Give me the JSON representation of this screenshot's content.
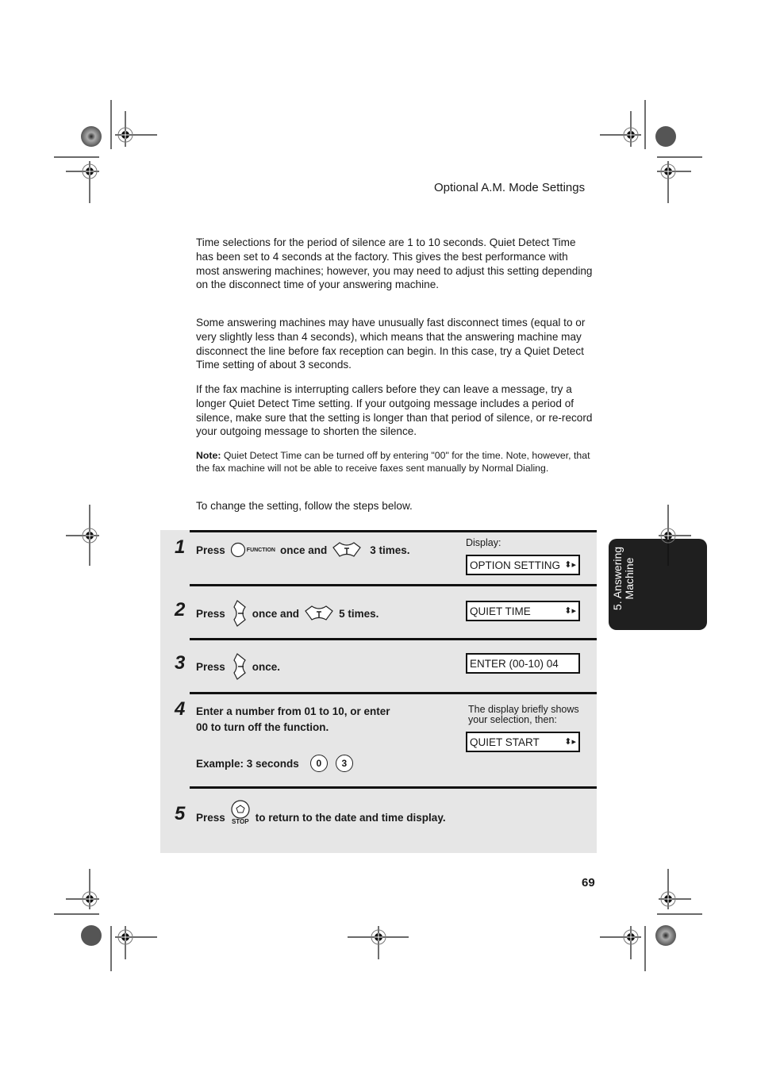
{
  "header": {
    "section_title": "Optional A.M. Mode Settings"
  },
  "body": {
    "paragraphs": [
      "Time selections for the period of silence are 1 to 10 seconds. Quiet Detect Time has been set to 4 seconds at the factory. This gives the best performance with most answering machines; however, you may need to adjust this setting depending on the disconnect time of your answering machine.",
      "Some answering machines may have unusually fast disconnect times (equal to or very slightly less than 4 seconds), which means that the answering machine may disconnect the line before fax reception can begin. In this case, try a Quiet Detect Time setting of about 3 seconds.",
      "If the fax machine is interrupting callers before they can leave a message, try a longer Quiet Detect Time setting. If your outgoing message includes a period of silence, make sure that the setting is longer than that period of silence, or re-record your outgoing message to shorten the silence."
    ],
    "note_label": "Note:",
    "note_text": " Quiet Detect Time can be turned off by entering \"00\" for the time. Note, however, that the fax machine will not be able to receive faxes sent manually by Normal Dialing.",
    "intro": "To change the setting, follow the steps below."
  },
  "steps": [
    {
      "number": "1",
      "press": "Press",
      "key1": "FUNCTION",
      "mid": "once and",
      "end": "3 times.",
      "display_label": "Display:",
      "display": "OPTION SETTING"
    },
    {
      "number": "2",
      "press": "Press",
      "mid": "once and",
      "end": "5 times.",
      "display": "QUIET TIME"
    },
    {
      "number": "3",
      "press": "Press",
      "end": "once.",
      "display": "ENTER (00-10) 04"
    },
    {
      "number": "4",
      "line1": "Enter a number from 01 to 10, or enter",
      "line2": "00 to turn off the function.",
      "example": "Example: 3 seconds",
      "keys": [
        "0",
        "3"
      ],
      "display_note": "The display briefly shows your selection, then:",
      "display": "QUIET START"
    },
    {
      "number": "5",
      "press": "Press",
      "key_label": "STOP",
      "end": "to return to the date and time display."
    }
  ],
  "side_tab": {
    "line1": "5. Answering",
    "line2": "Machine"
  },
  "footer": {
    "page_number": "69"
  },
  "colors": {
    "panel": "#e6e6e6",
    "tab": "#1f1f1f"
  }
}
